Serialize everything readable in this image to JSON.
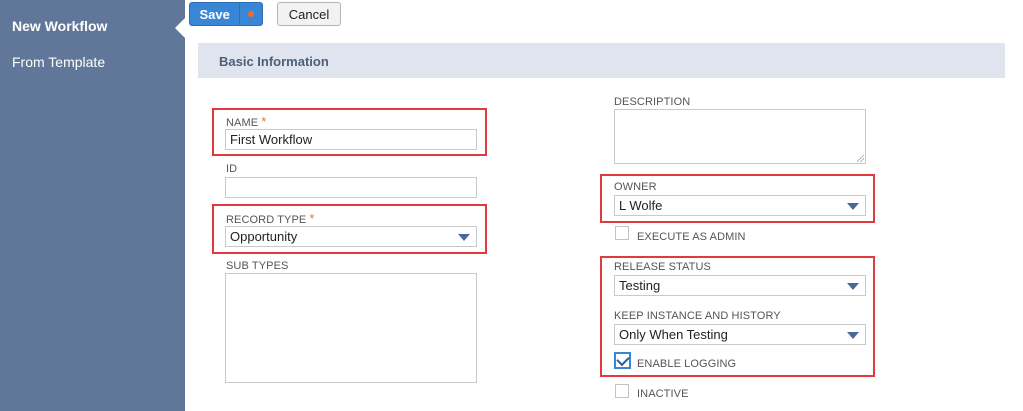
{
  "sidebar": {
    "items": [
      {
        "label": "New Workflow"
      },
      {
        "label": "From Template"
      }
    ]
  },
  "toolbar": {
    "save_label": "Save",
    "cancel_label": "Cancel"
  },
  "section": {
    "title": "Basic Information"
  },
  "form": {
    "name": {
      "label": "NAME",
      "required_mark": "*",
      "value": "First Workflow"
    },
    "id": {
      "label": "ID",
      "value": ""
    },
    "record_type": {
      "label": "RECORD TYPE",
      "required_mark": "*",
      "value": "Opportunity"
    },
    "sub_types": {
      "label": "SUB TYPES"
    },
    "description": {
      "label": "DESCRIPTION",
      "value": ""
    },
    "owner": {
      "label": "OWNER",
      "value": "L Wolfe"
    },
    "execute_as_admin": {
      "label": "EXECUTE AS ADMIN",
      "checked": false
    },
    "release_status": {
      "label": "RELEASE STATUS",
      "value": "Testing"
    },
    "keep_instance": {
      "label": "KEEP INSTANCE AND HISTORY",
      "value": "Only When Testing"
    },
    "enable_logging": {
      "label": "ENABLE LOGGING",
      "checked": true
    },
    "inactive": {
      "label": "INACTIVE",
      "checked": false
    }
  },
  "colors": {
    "sidebar_bg": "#607799",
    "save_button": "#3a86d6",
    "highlight_border": "#e0393e",
    "section_bar": "#dfe4ee"
  }
}
